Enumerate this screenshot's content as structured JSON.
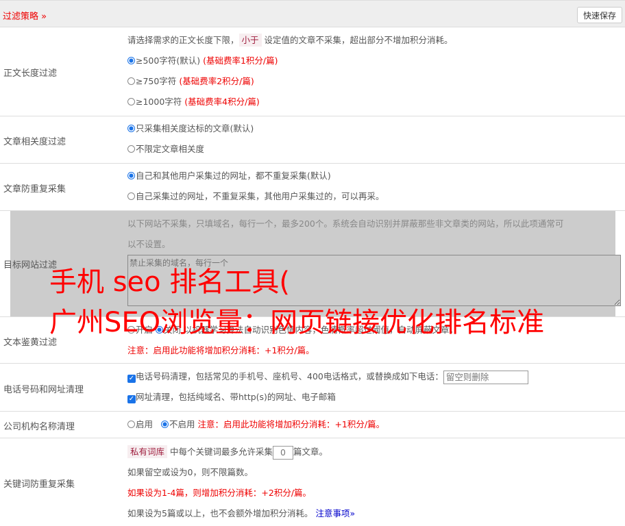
{
  "header": {
    "title": "过滤策略 »",
    "save": "快速保存"
  },
  "length": {
    "label": "正文长度过滤",
    "desc_a": "请选择需求的正文长度下限，",
    "desc_tag": "小于",
    "desc_b": " 设定值的文章不采集，超出部分不增加积分消耗。",
    "options": [
      {
        "text": "≥500字符(默认)",
        "note": "(基础费率1积分/篇)",
        "checked": true
      },
      {
        "text": "≥750字符",
        "note": "(基础费率2积分/篇)",
        "checked": false
      },
      {
        "text": "≥1000字符",
        "note": "(基础费率4积分/篇)",
        "checked": false
      }
    ]
  },
  "relevance": {
    "label": "文章相关度过滤",
    "options": [
      "只采集相关度达标的文章(默认)",
      "不限定文章相关度"
    ]
  },
  "dup": {
    "label": "文章防重复采集",
    "options": [
      "自己和其他用户采集过的网址，都不重复采集(默认)",
      "自己采集过的网址，不重复采集，其他用户采集过的，可以再采。"
    ]
  },
  "site": {
    "label": "目标网站过滤",
    "desc1": "以下网站不采集，只填域名，每行一个，最多200个。系统会自动识别并屏蔽那些非文章类的网站，所以此项通常可",
    "desc2": "以不设置。",
    "placeholder": "禁止采集的域名，每行一个"
  },
  "porn": {
    "label": "文本鉴黄过滤",
    "on": "开启",
    "off": "关闭",
    "desc": "以机器学习算法自动识别色情内容，色情概率超过阈值，自动屏蔽文章。",
    "note": "注意：启用此功能将增加积分消耗：+1积分/篇。"
  },
  "phone": {
    "label": "电话号码和网址清理",
    "opt1": "电话号码清理，包括常见的手机号、座机号、400电话格式，或替换成如下电话：",
    "placeholder": "留空则删除",
    "opt2": "网址清理，包括纯域名、带http(s)的网址、电子邮箱"
  },
  "company": {
    "label": "公司机构名称清理",
    "on": "启用",
    "off": "不启用",
    "note": "注意：启用此功能将增加积分消耗：+1积分/篇。"
  },
  "kw": {
    "label": "关键词防重复采集",
    "tag": "私有词库",
    "a": " 中每个关键词最多允许采集",
    "value": "0",
    "b": "篇文章。",
    "l2": "如果留空或设为0，则不限篇数。",
    "l3": "如果设为1-4篇，则增加积分消耗：+2积分/篇。",
    "l4": "如果设为5篇或以上，也不会额外增加积分消耗。",
    "link": "注意事项»"
  },
  "watermark": {
    "line1": "手机 seo 排名工具(",
    "line2": "广州SEO浏览量：网页链接优化排名标准"
  }
}
